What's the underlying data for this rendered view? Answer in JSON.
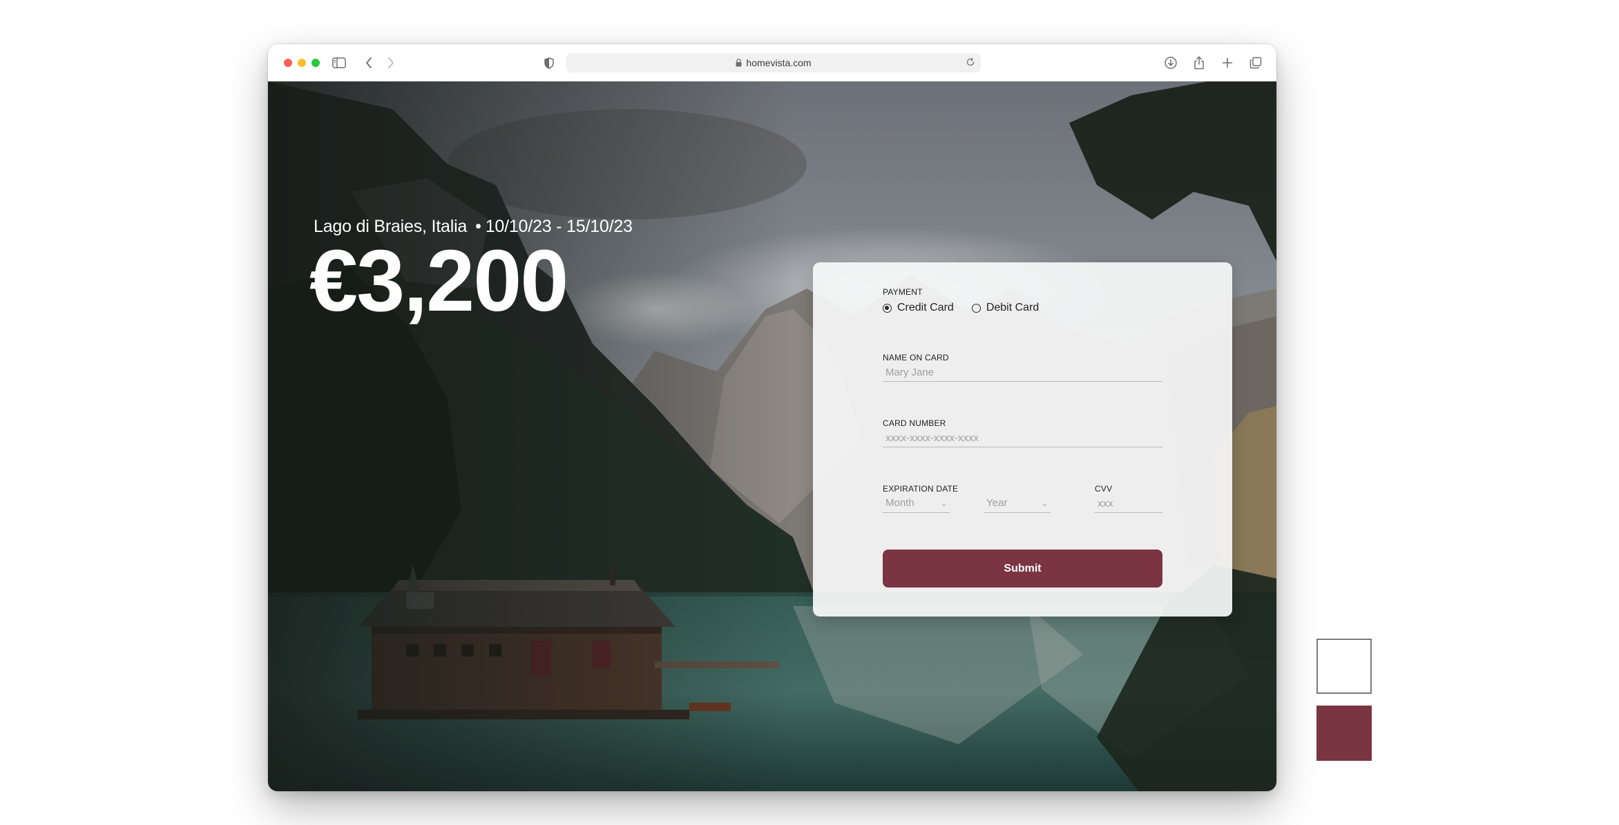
{
  "browser": {
    "url": "homevista.com"
  },
  "trip": {
    "location": "Lago di Braies, Italia",
    "separator": "•",
    "dates": "10/10/23 - 15/10/23",
    "price": "€3,200"
  },
  "payment_form": {
    "payment_label": "PAYMENT",
    "payment_options": [
      "Credit Card",
      "Debit Card"
    ],
    "selected_option": "Credit Card",
    "name_label": "NAME ON CARD",
    "name_placeholder": "Mary Jane",
    "card_number_label": "CARD NUMBER",
    "card_number_placeholder": "xxxx-xxxx-xxxx-xxxx",
    "expiration_label": "EXPIRATION DATE",
    "month_placeholder": "Month",
    "year_placeholder": "Year",
    "cvv_label": "CVV",
    "cvv_placeholder": "xxx",
    "submit_label": "Submit"
  },
  "palette": {
    "accent": "#7b3441",
    "background": "#ffffff"
  }
}
